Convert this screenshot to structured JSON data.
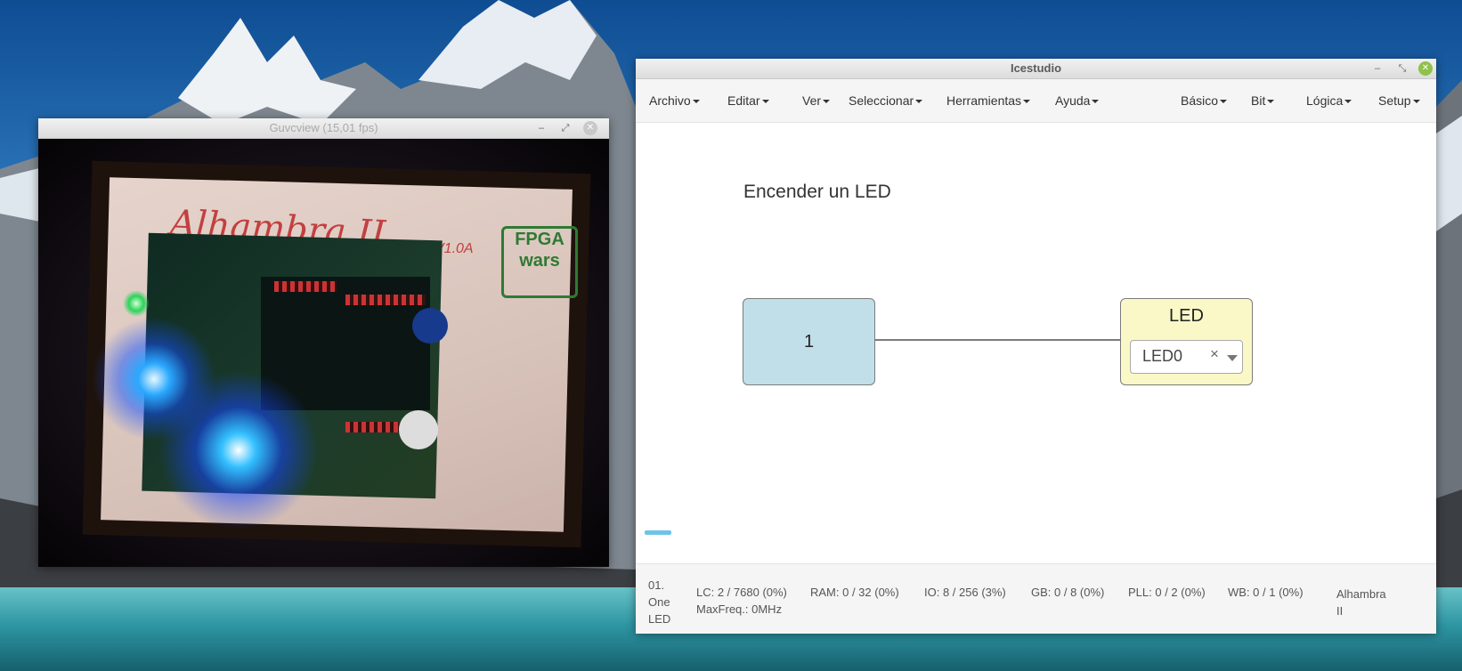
{
  "guvcview": {
    "title": "Guvcview  (15,01 fps)",
    "camera_text": {
      "board_name": "Alhambra II",
      "version": "V1.0A",
      "logo": "FPGA wars"
    }
  },
  "icestudio": {
    "title": "Icestudio",
    "menus_left": [
      "Archivo",
      "Editar",
      "Ver",
      "Seleccionar",
      "Herramientas",
      "Ayuda"
    ],
    "menus_right": [
      "Básico",
      "Bit",
      "Lógica",
      "Setup"
    ],
    "canvas": {
      "comment": "Encender un LED",
      "constant_block": {
        "value": "1"
      },
      "led_block": {
        "title": "LED",
        "selected_pin": "LED0",
        "clear_symbol": "×"
      }
    },
    "status": {
      "project_line1": "01.",
      "project_line2": "One",
      "project_line3": "LED",
      "lc": "LC:  2 / 7680 (0%)",
      "ram": "RAM:  0 / 32 (0%)",
      "io": "IO:  8 / 256 (3%)",
      "gb": "GB:  0 / 8 (0%)",
      "pll": "PLL:  0 / 2 (0%)",
      "wb": "WB:  0 / 1 (0%)",
      "maxfreq": "MaxFreq.:  0MHz",
      "board_line1": "Alhambra",
      "board_line2": "II"
    }
  },
  "colors": {
    "constant_block": "#c1dfe9",
    "led_block": "#fbf8c8",
    "close_button": "#8fc14b",
    "progress": "#6ec3ea"
  }
}
